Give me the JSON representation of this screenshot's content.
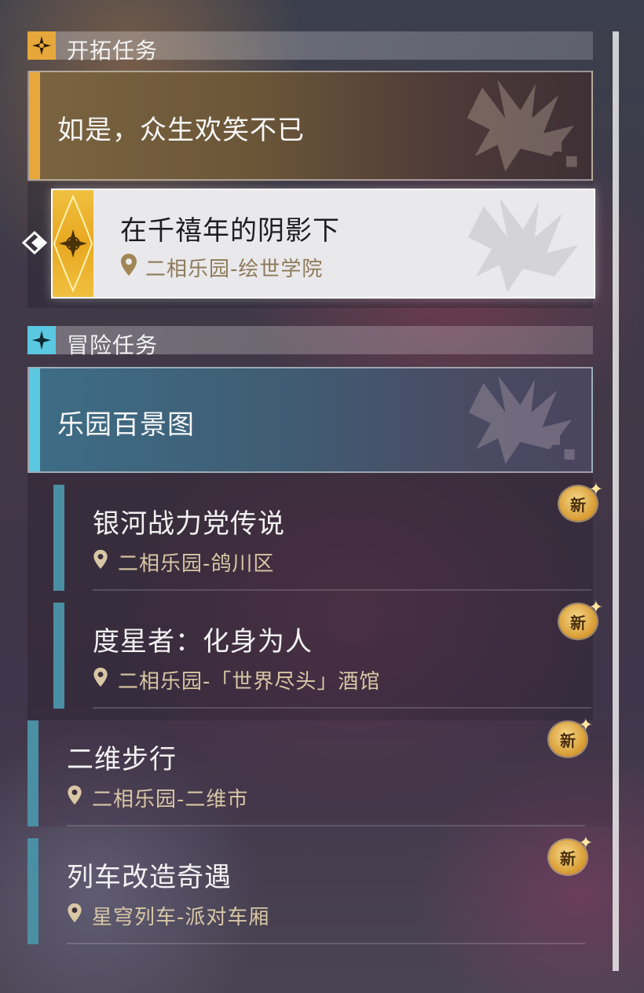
{
  "sections": {
    "trailblaze": {
      "label": "开拓任务",
      "icon": "trailblaze-star-icon"
    },
    "adventure": {
      "label": "冒险任务",
      "icon": "adventure-star-icon"
    }
  },
  "trailblaze_chapter": {
    "title": "如是，众生欢笑不已"
  },
  "selected_quest": {
    "title": "在千禧年的阴影下",
    "location": "二相乐园-绘世学院"
  },
  "adventure_chapter": {
    "title": "乐园百景图"
  },
  "quests": [
    {
      "title": "银河战力党传说",
      "location": "二相乐园-鸽川区",
      "badge": "新"
    },
    {
      "title": "度星者：化身为人",
      "location": "二相乐园-「世界尽头」酒馆",
      "badge": "新"
    },
    {
      "title": "二维步行",
      "location": "二相乐园-二维市",
      "badge": "新"
    },
    {
      "title": "列车改造奇遇",
      "location": "星穹列车-派对车厢",
      "badge": "新"
    }
  ],
  "colors": {
    "trailblaze_accent": "#e6a83a",
    "adventure_accent": "#5ac8e0",
    "quest_bar": "#4a8fa3",
    "location_text": "#d8c7a5"
  }
}
